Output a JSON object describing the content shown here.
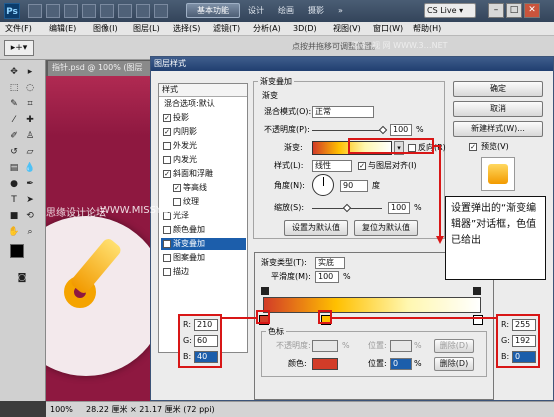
{
  "app": {
    "logo": "Ps",
    "workspace_button": "基本功能",
    "workspaces": [
      "设计",
      "绘画",
      "摄影"
    ],
    "overflow": "»",
    "cslive": "CS Live ▾",
    "window_buttons": [
      "–",
      "□",
      "✕"
    ]
  },
  "menu": [
    "文件(F)",
    "编辑(E)",
    "图像(I)",
    "图层(L)",
    "选择(S)",
    "滤镜(T)",
    "分析(A)",
    "3D(D)",
    "视图(V)",
    "窗口(W)",
    "帮助(H)"
  ],
  "options_bar": {
    "tool_preset": "▸+▾",
    "hint": "点按并拖移可调整位置。"
  },
  "document": {
    "tab_title": "指针.psd @ 100% (图层",
    "zoom": "100%",
    "size_info": "28.22 厘米 × 21.17 厘米 (72 ppi)"
  },
  "watermark": {
    "left": "思缘设计论坛",
    "center": "WWW.MISSYUAN.COM",
    "top": "腾 缩 视 网 WWW.3…NET"
  },
  "dialog": {
    "title": "图层样式",
    "styles_header": "样式",
    "blend_default": "混合选项:默认",
    "style_items": [
      {
        "label": "投影",
        "checked": true,
        "mark": "✓"
      },
      {
        "label": "内阴影",
        "checked": true,
        "mark": "✓"
      },
      {
        "label": "外发光",
        "checked": false,
        "mark": ""
      },
      {
        "label": "内发光",
        "checked": false,
        "mark": ""
      },
      {
        "label": "斜面和浮雕",
        "checked": true,
        "mark": "✓"
      },
      {
        "label": "等高线",
        "checked": true,
        "mark": "✓"
      },
      {
        "label": "纹理",
        "checked": false,
        "mark": ""
      },
      {
        "label": "光泽",
        "checked": false,
        "mark": ""
      },
      {
        "label": "颜色叠加",
        "checked": false,
        "mark": ""
      },
      {
        "label": "渐变叠加",
        "checked": true,
        "mark": "✓",
        "selected": true
      },
      {
        "label": "图案叠加",
        "checked": false,
        "mark": ""
      },
      {
        "label": "描边",
        "checked": false,
        "mark": ""
      }
    ],
    "section_title": "渐变叠加",
    "sub_title": "渐变",
    "blend_mode_label": "混合模式(O):",
    "blend_mode_value": "正常",
    "opacity_label": "不透明度(P):",
    "opacity_value": "100",
    "percent": "%",
    "gradient_label": "渐变:",
    "reverse_label": "反向(R)",
    "style_label": "样式(L):",
    "style_value": "线性",
    "align_label": "与图层对齐(I)",
    "angle_label": "角度(N):",
    "angle_value": "90",
    "degree": "度",
    "scale_label": "缩放(S):",
    "scale_value": "100",
    "make_default": "设置为默认值",
    "reset_default": "复位为默认值",
    "buttons": {
      "ok": "确定",
      "cancel": "取消",
      "new_style": "新建样式(W)...",
      "preview": "预览(V)"
    }
  },
  "gradient_editor": {
    "type_label": "渐变类型(T):",
    "type_value": "实底",
    "smooth_label": "平滑度(M):",
    "smooth_value": "100",
    "stops_label": "色标",
    "opacity_label": "不透明度:",
    "location_label": "位置:",
    "delete_label": "删除(D)",
    "color_label": "颜色:",
    "color_location": "0",
    "percent": "%"
  },
  "left_rgb": {
    "r_label": "R:",
    "r": "210",
    "g_label": "G:",
    "g": "60",
    "b_label": "B:",
    "b": "40"
  },
  "right_rgb": {
    "r_label": "R:",
    "r": "255",
    "g_label": "G:",
    "g": "192",
    "b_label": "B:",
    "b": "0"
  },
  "callout": "设置弹出的“渐变编辑器”对话框，色值已给出",
  "colors": {
    "canvas": "#8e1840",
    "gradient_start": "#d23c28",
    "gradient_mid": "#ffc000",
    "accent_red": "#d81616"
  }
}
